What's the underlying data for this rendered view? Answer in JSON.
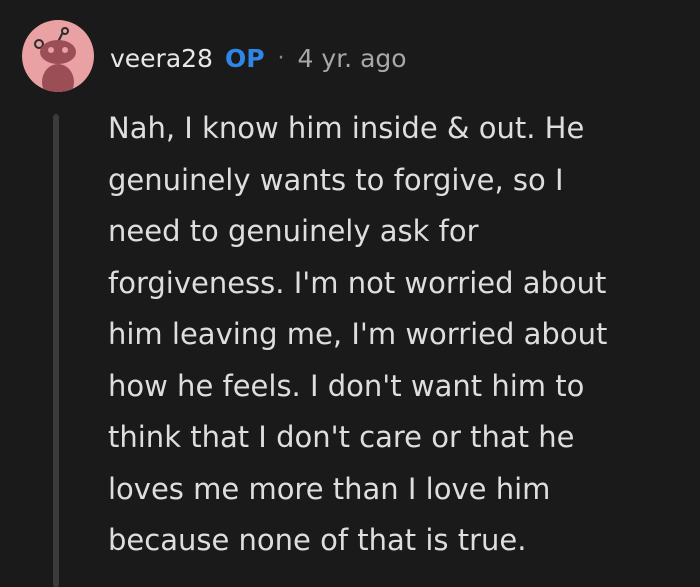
{
  "comment": {
    "author": "veera28",
    "badge": "OP",
    "separator": "·",
    "timestamp": "4 yr. ago",
    "body": "Nah, I know him inside & out. He\ngenuinely wants to forgive, so I\nneed to genuinely ask for\nforgiveness. I'm not worried about\nhim leaving me, I'm worried about\nhow he feels. I don't want him to\nthink that I don't care or that he\nloves me more than I love him\nbecause none of that is true."
  },
  "colors": {
    "background": "#1a1a1b",
    "avatar": "#e9a1a4",
    "op_badge": "#2f86e6",
    "text": "#dedede"
  },
  "icons": {
    "avatar": "snoo-avatar-icon"
  }
}
